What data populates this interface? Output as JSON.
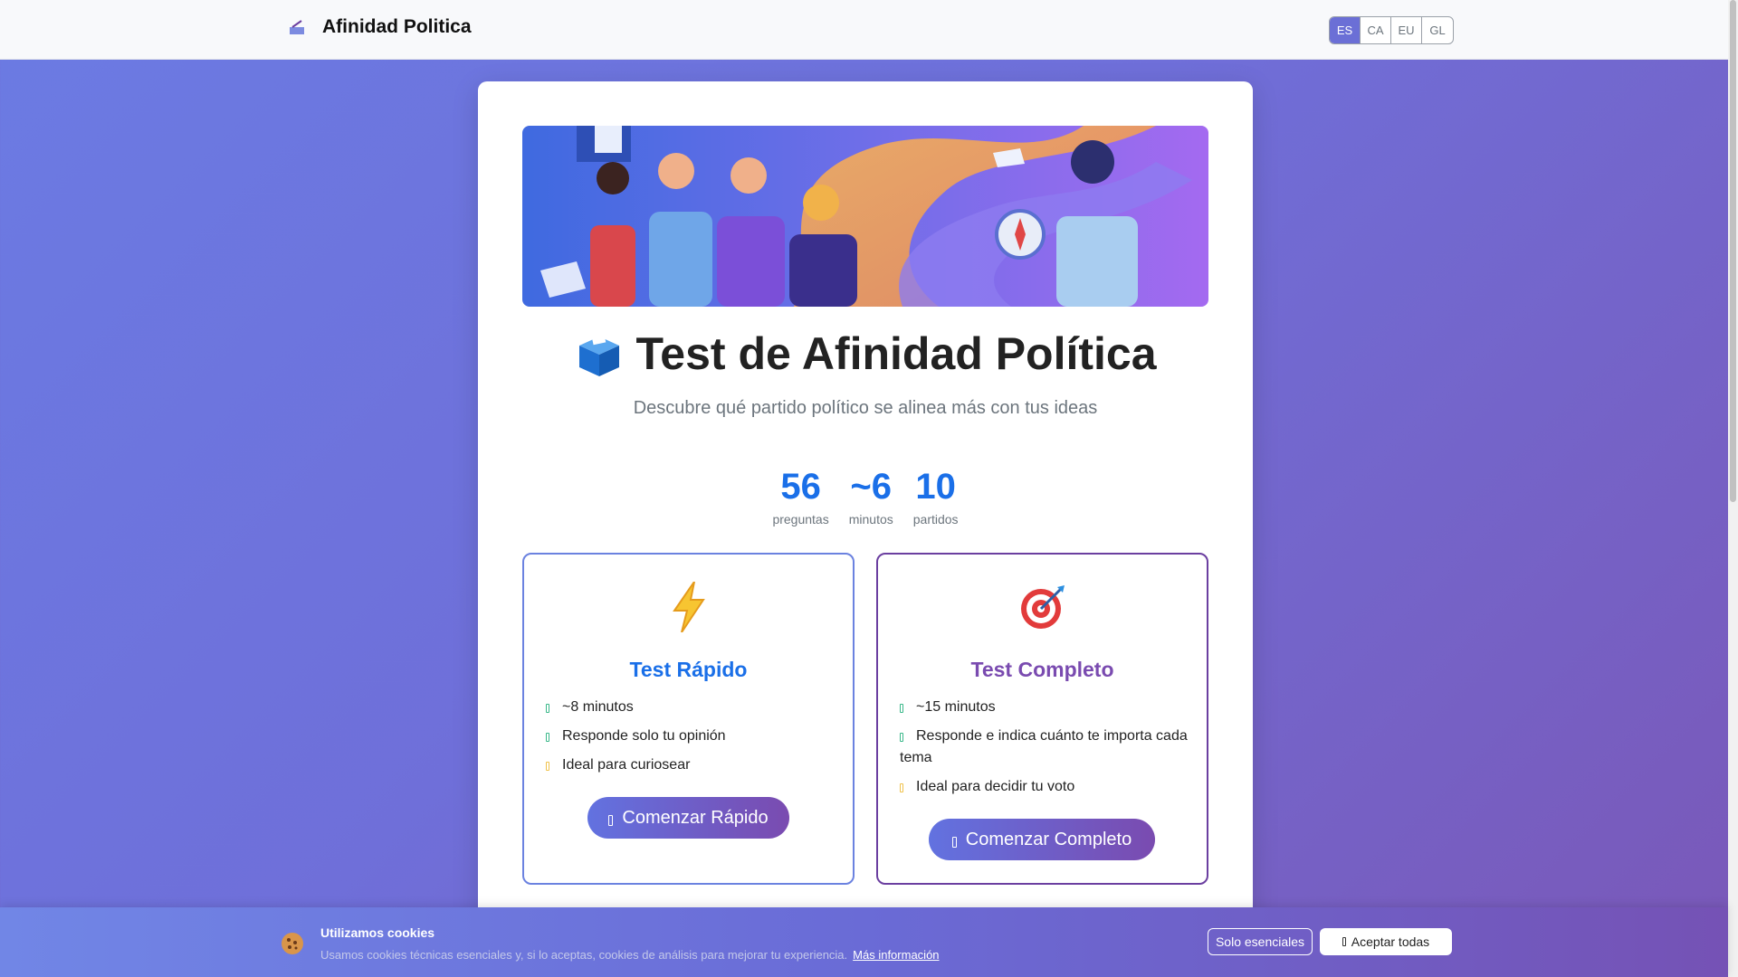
{
  "header": {
    "brand_name": "Afinidad Politica",
    "languages": [
      "ES",
      "CA",
      "EU",
      "GL"
    ],
    "active_language": "ES"
  },
  "main": {
    "title": "Test de Afinidad Política",
    "subtitle": "Descubre qué partido político se alinea más con tus ideas",
    "stats": [
      {
        "value": "56",
        "label": "preguntas"
      },
      {
        "value": "~6",
        "label": "minutos"
      },
      {
        "value": "10",
        "label": "partidos"
      }
    ],
    "quick": {
      "title": "Test Rápido",
      "items": [
        "~8 minutos",
        "Responde solo tu opinión",
        "Ideal para curiosear"
      ],
      "button": "Comenzar Rápido"
    },
    "full": {
      "title": "Test Completo",
      "items": [
        "~15 minutos",
        "Responde e indica cuánto te importa cada tema",
        "Ideal para decidir tu voto"
      ],
      "button": "Comenzar Completo"
    }
  },
  "cookie": {
    "title": "Utilizamos cookies",
    "text": "Usamos cookies técnicas esenciales y, si lo aceptas, cookies de análisis para mejorar tu experiencia.",
    "link": "Más información",
    "essential_button": "Solo esenciales",
    "accept_button": "Aceptar todas"
  },
  "colors": {
    "accent_blue": "#1a6fe8",
    "accent_purple": "#7a4bb0",
    "background_gradient_start": "#6b7be3",
    "background_gradient_end": "#7a58b8"
  }
}
